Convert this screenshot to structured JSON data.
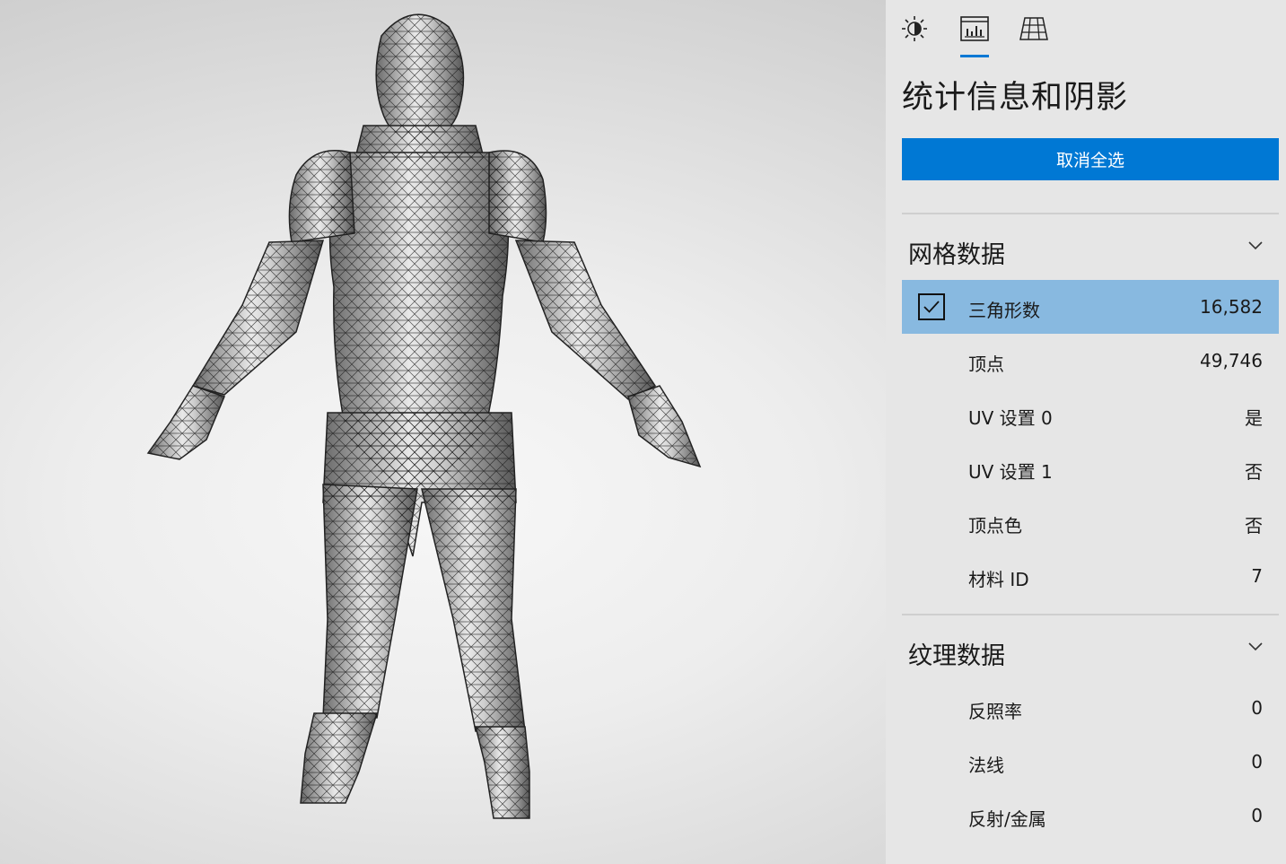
{
  "tabs": [
    {
      "name": "lighting-icon",
      "active": false
    },
    {
      "name": "stats-icon",
      "active": true
    },
    {
      "name": "mesh-grid-icon",
      "active": false
    }
  ],
  "panel": {
    "title": "统计信息和阴影",
    "deselect_all_label": "取消全选"
  },
  "mesh_section": {
    "title": "网格数据",
    "rows": [
      {
        "label": "三角形数",
        "value": "16,582",
        "selected": true,
        "checked": true
      },
      {
        "label": "顶点",
        "value": "49,746"
      },
      {
        "label": "UV 设置 0",
        "value": "是"
      },
      {
        "label": "UV 设置 1",
        "value": "否"
      },
      {
        "label": "顶点色",
        "value": "否"
      },
      {
        "label": "材料 ID",
        "value": "7"
      }
    ]
  },
  "texture_section": {
    "title": "纹理数据",
    "rows": [
      {
        "label": "反照率",
        "value": "0"
      },
      {
        "label": "法线",
        "value": "0"
      },
      {
        "label": "反射/金属",
        "value": "0"
      }
    ]
  },
  "colors": {
    "accent": "#0078d4",
    "selected_row": "#88b9e0",
    "panel_bg": "#e6e6e6"
  }
}
